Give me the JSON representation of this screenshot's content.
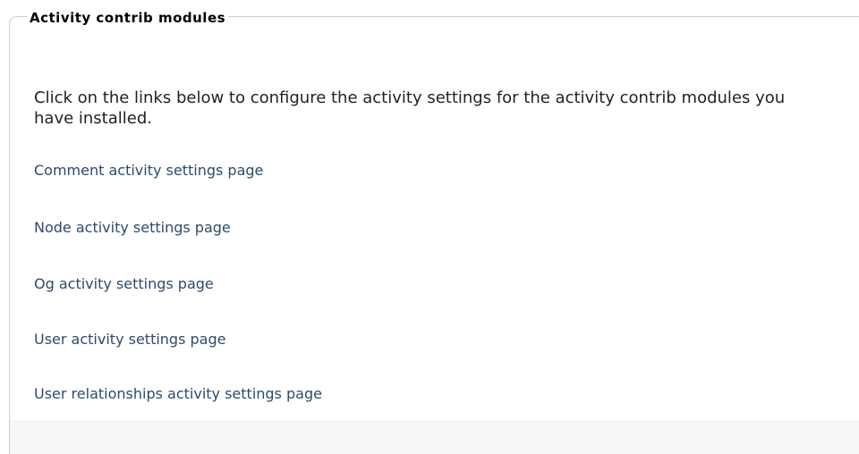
{
  "fieldset": {
    "legend": "Activity contrib modules",
    "description": "Click on the links below to configure the activity settings for the activity contrib modules you have installed."
  },
  "links": [
    {
      "label": "Comment activity settings page"
    },
    {
      "label": "Node activity settings page"
    },
    {
      "label": "Og activity settings page"
    },
    {
      "label": "User activity settings page"
    },
    {
      "label": "User relationships activity settings page"
    }
  ],
  "colors": {
    "link": "#2c4a6e",
    "text": "#222222",
    "border": "#cfcfcf",
    "fieldset_bottom": "#f6f6f6"
  }
}
